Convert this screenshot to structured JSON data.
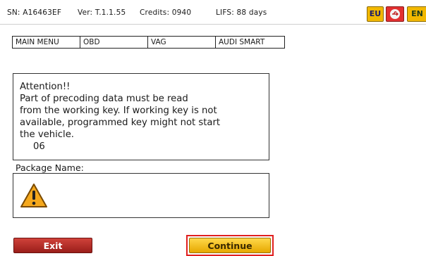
{
  "status_bar": {
    "serial": "SN: A16463EF",
    "version": "Ver: T.1.1.55",
    "credits": "Credits: 0940",
    "lifs": "LIFS: 88 days",
    "flags": [
      {
        "label": "EU",
        "icon": "eu-flag-icon"
      },
      {
        "label": "",
        "icon": "usb-icon"
      },
      {
        "label": "EN",
        "icon": "en-flag-icon"
      }
    ]
  },
  "breadcrumb": [
    "MAIN MENU",
    "OBD",
    "VAG",
    "AUDI SMART"
  ],
  "attention": {
    "title": "Attention!!",
    "lines": [
      "Part of precoding data must be read",
      "from the working key. If working key is not",
      "available, programmed key might not start",
      "the vehicle."
    ],
    "code": "06"
  },
  "package": {
    "label": "Package Name:",
    "icon": "warning-icon"
  },
  "buttons": {
    "exit": "Exit",
    "continue": "Continue"
  },
  "colors": {
    "exit_button": "#b32a24",
    "continue_button": "#f2c21a",
    "highlight_frame": "#e02020"
  }
}
